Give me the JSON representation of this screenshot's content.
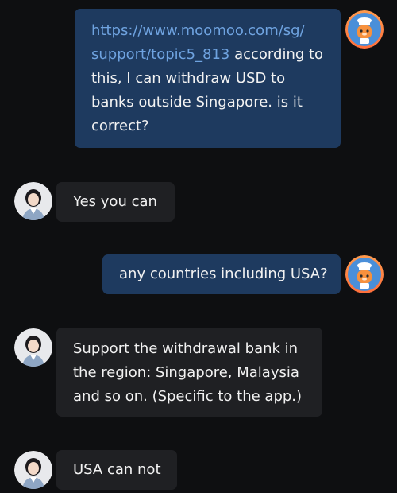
{
  "messages": [
    {
      "sender": "user",
      "link_text": "https://www.moomoo.com/sg/ support/topic5_813",
      "link_line1": "https://www.moomoo.com/sg/",
      "link_line2": "support/topic5_813",
      "line2_rest": " according to",
      "line3": "this, I can withdraw USD to",
      "line4": "banks outside Singapore. is it",
      "line5": "correct?"
    },
    {
      "sender": "agent",
      "line1": "Yes you can"
    },
    {
      "sender": "user",
      "line1": "any countries including USA?"
    },
    {
      "sender": "agent",
      "line1": "Support the withdrawal bank in",
      "line2": "the region: Singapore, Malaysia",
      "line3": "and so on. (Specific to the app.)"
    },
    {
      "sender": "agent",
      "line1": "USA can not"
    }
  ],
  "avatars": {
    "user": "mascot-chef-avatar-icon",
    "agent": "support-agent-avatar-icon"
  },
  "colors": {
    "background": "#0e0f11",
    "user_bubble": "#1e3a5f",
    "agent_bubble": "#1f2023",
    "link": "#6fa3e0",
    "text": "#f2f2f2"
  }
}
